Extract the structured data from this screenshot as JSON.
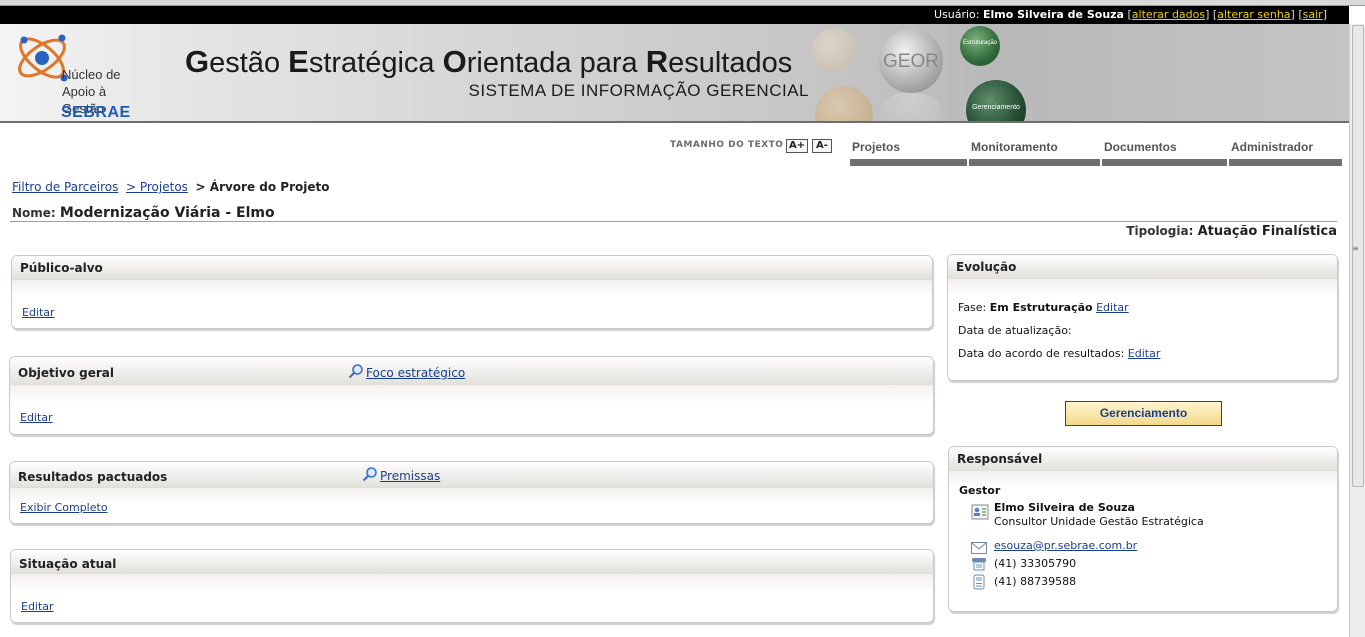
{
  "topbar": {
    "user_label": "Usuário:",
    "user_name": "Elmo Silveira de Souza",
    "links": [
      "alterar dados",
      "alterar senha",
      "sair"
    ]
  },
  "banner": {
    "logo_lines": [
      "Núcleo de",
      "Apoio à Gestão"
    ],
    "logo_brand": "SEBRAE",
    "title_parts": [
      {
        "cap": "G",
        "rest": "estão "
      },
      {
        "cap": "E",
        "rest": "stratégica "
      },
      {
        "cap": "O",
        "rest": "rientada para "
      },
      {
        "cap": "R",
        "rest": "esultados"
      }
    ],
    "subtitle": "SISTEMA DE INFORMAÇÃO GERENCIAL",
    "ball_geor": "GEOR",
    "ball_estruturacao": "Estruturação",
    "ball_gerenciamento": "Gerenciamento"
  },
  "text_size": {
    "label": "TAMANHO DO TEXTO",
    "increase": "A+",
    "decrease": "A-"
  },
  "nav": [
    "Projetos",
    "Monitoramento",
    "Documentos",
    "Administrador"
  ],
  "breadcrumb": {
    "items": [
      "Filtro de Parceiros",
      "> Projetos"
    ],
    "current": "> Árvore do Projeto"
  },
  "project": {
    "nome_label": "Nome:",
    "nome": "Modernização Viária - Elmo",
    "tipologia_label": "Tipologia:",
    "tipologia": "Atuação Finalística"
  },
  "panels": {
    "publico": {
      "title": "Público-alvo",
      "link": "Editar"
    },
    "objetivo": {
      "title": "Objetivo geral",
      "header_link": "Foco estratégico",
      "link": "Editar"
    },
    "resultados": {
      "title": "Resultados pactuados",
      "header_link": "Premissas",
      "link": "Exibir Completo"
    },
    "situacao": {
      "title": "Situação atual",
      "link": "Editar"
    }
  },
  "evolucao": {
    "title": "Evolução",
    "fase_label": "Fase:",
    "fase_value": "Em Estruturação",
    "fase_link": "Editar",
    "data_atualizacao_label": "Data de atualização:",
    "data_acordo_label": "Data do acordo de resultados:",
    "data_acordo_link": "Editar"
  },
  "gerenciamento_button": "Gerenciamento",
  "responsavel": {
    "title": "Responsável",
    "role": "Gestor",
    "name": "Elmo Silveira de Souza",
    "position": "Consultor Unidade Gestão Estratégica",
    "email": "esouza@pr.sebrae.com.br",
    "phone": "(41) 33305790",
    "mobile": "(41) 88739588"
  }
}
